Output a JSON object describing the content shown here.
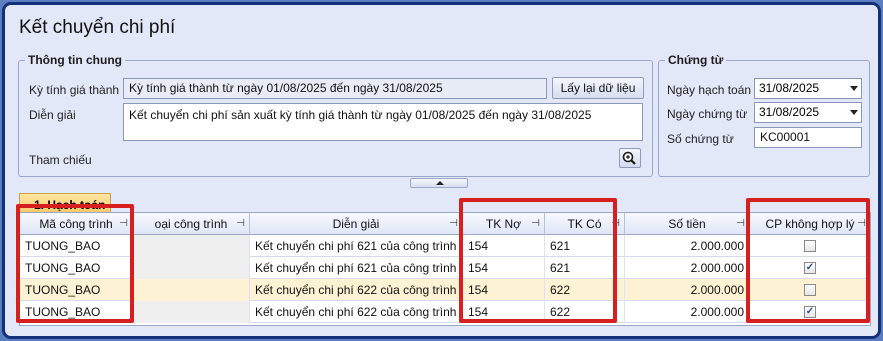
{
  "window": {
    "title": "Kết chuyển chi phí"
  },
  "general": {
    "legend": "Thông tin chung",
    "period_label": "Kỳ tính giá thành",
    "period_value": "Kỳ tính giá thành từ ngày 01/08/2025 đến ngày 31/08/2025",
    "reload_button": "Lấy lại dữ liệu",
    "description_label": "Diễn giải",
    "description_value": "Kết chuyển chi phí sản xuất kỳ tính giá thành từ ngày 01/08/2025 đến ngày 31/08/2025",
    "reference_label": "Tham chiếu"
  },
  "voucher": {
    "legend": "Chứng từ",
    "posting_date_label": "Ngày hạch toán",
    "posting_date_value": "31/08/2025",
    "voucher_date_label": "Ngày chứng từ",
    "voucher_date_value": "31/08/2025",
    "voucher_no_label": "Số chứng từ",
    "voucher_no_value": "KC00001"
  },
  "tabs": [
    {
      "label": "1. Hạch toán"
    }
  ],
  "grid": {
    "columns": {
      "code": "Mã công trình",
      "type": "oại công trình",
      "description": "Diễn giải",
      "debit": "TK Nợ",
      "credit": "TK Có",
      "amount": "Số tiền",
      "unreasonable": "CP không hợp lý"
    },
    "rows": [
      {
        "code": "TUONG_BAO",
        "type": "",
        "description": "Kết chuyển chi phí 621 của công trình T",
        "debit": "154",
        "credit": "621",
        "amount": "2.000.000",
        "checked": false
      },
      {
        "code": "TUONG_BAO",
        "type": "",
        "description": "Kết chuyển chi phí 621 của công trình T",
        "debit": "154",
        "credit": "621",
        "amount": "2.000.000",
        "checked": true
      },
      {
        "code": "TUONG_BAO",
        "type": "",
        "description": "Kết chuyển chi phí 622 của công trình T",
        "debit": "154",
        "credit": "622",
        "amount": "2.000.000",
        "checked": false
      },
      {
        "code": "TUONG_BAO",
        "type": "",
        "description": "Kết chuyển chi phí 622 của công trình T",
        "debit": "154",
        "credit": "622",
        "amount": "2.000.000",
        "checked": true
      }
    ]
  },
  "icons": {
    "pin": "pin-icon",
    "magnifier": "magnifier-icon",
    "dropdown": "chevron-down-icon"
  },
  "colors": {
    "highlight_border": "#d71f1f",
    "selected_row": "#fdf3d4",
    "frame": "#15307a"
  }
}
